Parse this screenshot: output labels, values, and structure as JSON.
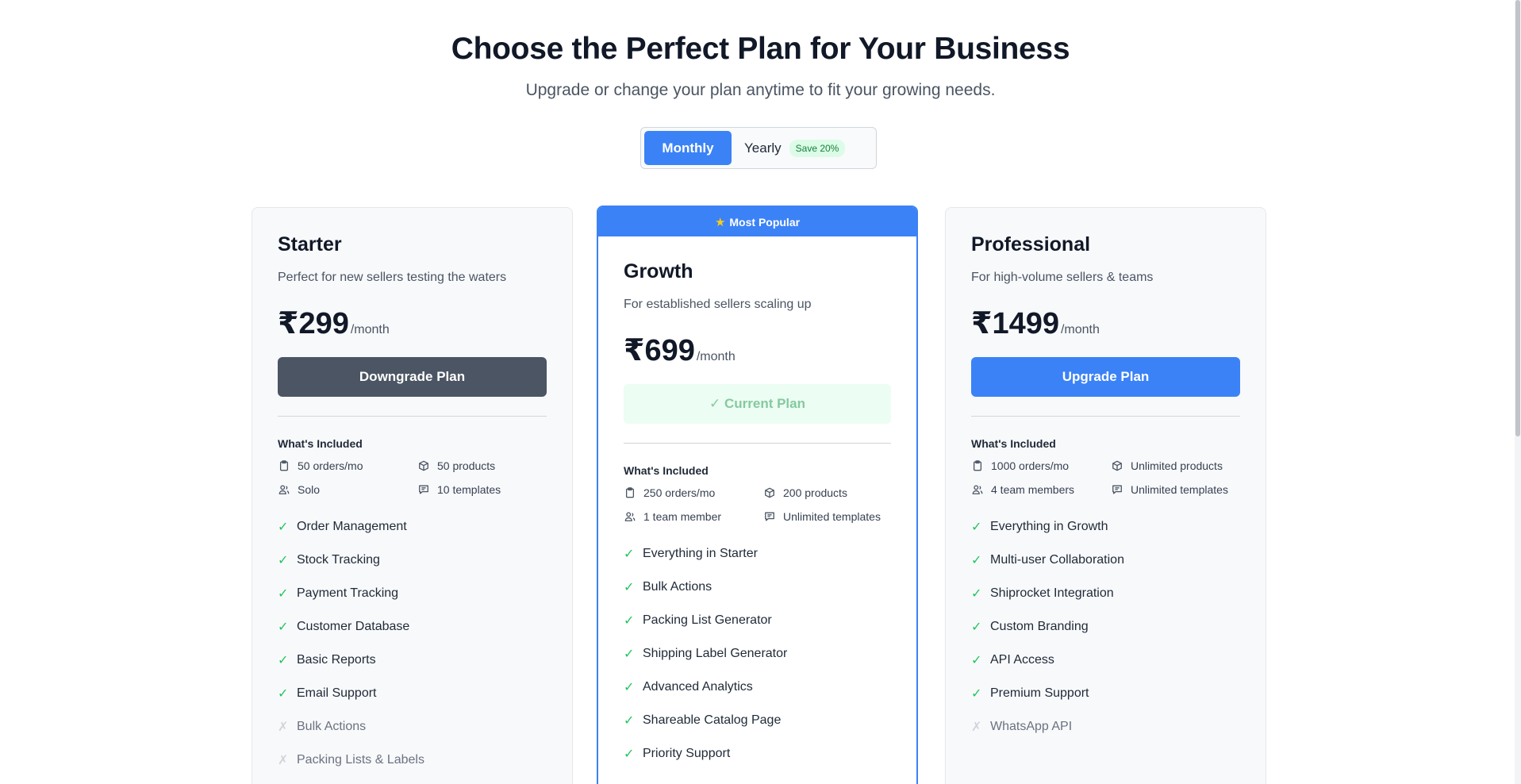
{
  "header": {
    "title": "Choose the Perfect Plan for Your Business",
    "subtitle": "Upgrade or change your plan anytime to fit your growing needs."
  },
  "billing_toggle": {
    "monthly_label": "Monthly",
    "yearly_label": "Yearly",
    "save_badge": "Save 20%",
    "selected": "Monthly"
  },
  "plans": [
    {
      "name": "Starter",
      "description": "Perfect for new sellers testing the waters",
      "price": "₹299",
      "period": "/month",
      "cta_label": "Downgrade Plan",
      "included_title": "What's Included",
      "limits": [
        {
          "icon": "clipboard-icon",
          "text": "50 orders/mo"
        },
        {
          "icon": "box-icon",
          "text": "50 products"
        },
        {
          "icon": "users-icon",
          "text": "Solo"
        },
        {
          "icon": "message-icon",
          "text": "10 templates"
        }
      ],
      "features": [
        {
          "text": "Order Management",
          "included": true
        },
        {
          "text": "Stock Tracking",
          "included": true
        },
        {
          "text": "Payment Tracking",
          "included": true
        },
        {
          "text": "Customer Database",
          "included": true
        },
        {
          "text": "Basic Reports",
          "included": true
        },
        {
          "text": "Email Support",
          "included": true
        },
        {
          "text": "Bulk Actions",
          "included": false
        },
        {
          "text": "Packing Lists & Labels",
          "included": false
        }
      ]
    },
    {
      "badge": "Most Popular",
      "name": "Growth",
      "description": "For established sellers scaling up",
      "price": "₹699",
      "period": "/month",
      "cta_label": "✓ Current Plan",
      "included_title": "What's Included",
      "limits": [
        {
          "icon": "clipboard-icon",
          "text": "250 orders/mo"
        },
        {
          "icon": "box-icon",
          "text": "200 products"
        },
        {
          "icon": "users-icon",
          "text": "1 team member"
        },
        {
          "icon": "message-icon",
          "text": "Unlimited templates"
        }
      ],
      "features": [
        {
          "text": "Everything in Starter",
          "included": true
        },
        {
          "text": "Bulk Actions",
          "included": true
        },
        {
          "text": "Packing List Generator",
          "included": true
        },
        {
          "text": "Shipping Label Generator",
          "included": true
        },
        {
          "text": "Advanced Analytics",
          "included": true
        },
        {
          "text": "Shareable Catalog Page",
          "included": true
        },
        {
          "text": "Priority Support",
          "included": true
        }
      ]
    },
    {
      "name": "Professional",
      "description": "For high-volume sellers & teams",
      "price": "₹1499",
      "period": "/month",
      "cta_label": "Upgrade Plan",
      "included_title": "What's Included",
      "limits": [
        {
          "icon": "clipboard-icon",
          "text": "1000 orders/mo"
        },
        {
          "icon": "box-icon",
          "text": "Unlimited products"
        },
        {
          "icon": "users-icon",
          "text": "4 team members"
        },
        {
          "icon": "message-icon",
          "text": "Unlimited templates"
        }
      ],
      "features": [
        {
          "text": "Everything in Growth",
          "included": true
        },
        {
          "text": "Multi-user Collaboration",
          "included": true
        },
        {
          "text": "Shiprocket Integration",
          "included": true
        },
        {
          "text": "Custom Branding",
          "included": true
        },
        {
          "text": "API Access",
          "included": true
        },
        {
          "text": "Premium Support",
          "included": true
        },
        {
          "text": "WhatsApp API",
          "included": false
        }
      ]
    }
  ],
  "colors": {
    "accent": "#3b82f6",
    "check": "#22c55e",
    "dark_button": "#4b5563"
  }
}
